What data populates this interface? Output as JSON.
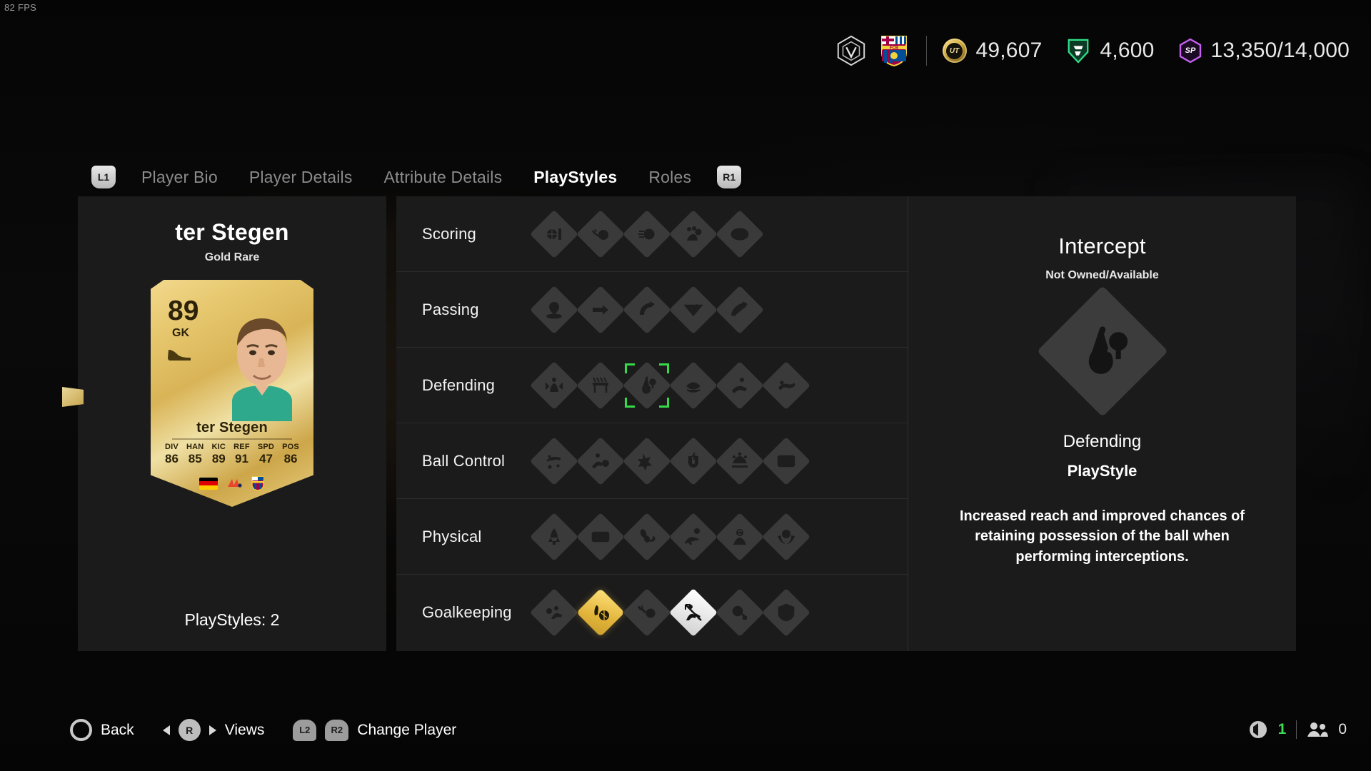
{
  "hud": {
    "fps": "82 FPS",
    "currencies": [
      {
        "id": "ut-coins",
        "icon": "ut-coin-icon",
        "value": "49,607"
      },
      {
        "id": "fc-points",
        "icon": "fc-points-icon",
        "value": "4,600"
      },
      {
        "id": "sp-points",
        "icon": "sp-points-icon",
        "value": "13,350/14,000"
      }
    ],
    "club_badge_icon": "club-crest-icon",
    "team_badge_icon": "fc-barcelona-crest-icon"
  },
  "nav": {
    "left_bumper": "L1",
    "right_bumper": "R1",
    "tabs": [
      {
        "label": "Player Bio",
        "active": false
      },
      {
        "label": "Player Details",
        "active": false
      },
      {
        "label": "Attribute Details",
        "active": false
      },
      {
        "label": "PlayStyles",
        "active": true
      },
      {
        "label": "Roles",
        "active": false
      }
    ]
  },
  "player": {
    "name": "ter Stegen",
    "rarity": "Gold Rare",
    "rating": "89",
    "position": "GK",
    "card_name": "ter Stegen",
    "nation": "Germany",
    "league": "LALIGA",
    "club": "FC Barcelona",
    "stats": [
      {
        "key": "DIV",
        "value": "86"
      },
      {
        "key": "HAN",
        "value": "85"
      },
      {
        "key": "KIC",
        "value": "89"
      },
      {
        "key": "REF",
        "value": "91"
      },
      {
        "key": "SPD",
        "value": "47"
      },
      {
        "key": "POS",
        "value": "86"
      }
    ],
    "playstyles_count_label": "PlayStyles: 2"
  },
  "categories": [
    {
      "label": "Scoring",
      "styles": [
        {
          "name": "finesse-shot",
          "icon": "finesse-shot-icon",
          "state": "unowned"
        },
        {
          "name": "chip-shot",
          "icon": "chip-shot-icon",
          "state": "unowned"
        },
        {
          "name": "power-shot",
          "icon": "power-shot-icon",
          "state": "unowned"
        },
        {
          "name": "dead-ball",
          "icon": "dead-ball-icon",
          "state": "unowned"
        },
        {
          "name": "power-header",
          "icon": "power-header-icon",
          "state": "unowned"
        }
      ]
    },
    {
      "label": "Passing",
      "styles": [
        {
          "name": "pinged-pass",
          "icon": "pinged-pass-icon",
          "state": "unowned"
        },
        {
          "name": "incisive-pass",
          "icon": "incisive-pass-icon",
          "state": "unowned"
        },
        {
          "name": "long-ball-pass",
          "icon": "long-ball-pass-icon",
          "state": "unowned"
        },
        {
          "name": "tiki-taka",
          "icon": "tiki-taka-icon",
          "state": "unowned"
        },
        {
          "name": "whipped-pass",
          "icon": "whipped-pass-icon",
          "state": "unowned"
        }
      ]
    },
    {
      "label": "Defending",
      "styles": [
        {
          "name": "block",
          "icon": "block-icon",
          "state": "unowned"
        },
        {
          "name": "bruiser",
          "icon": "bruiser-icon",
          "state": "unowned"
        },
        {
          "name": "intercept",
          "icon": "intercept-icon",
          "state": "unowned",
          "selected": true
        },
        {
          "name": "jockey",
          "icon": "jockey-icon",
          "state": "unowned"
        },
        {
          "name": "slide-tackle",
          "icon": "slide-tackle-icon",
          "state": "unowned"
        },
        {
          "name": "anticipate",
          "icon": "anticipate-icon",
          "state": "unowned"
        }
      ]
    },
    {
      "label": "Ball Control",
      "styles": [
        {
          "name": "first-touch",
          "icon": "first-touch-icon",
          "state": "unowned"
        },
        {
          "name": "flair",
          "icon": "flair-icon",
          "state": "unowned"
        },
        {
          "name": "press-proven",
          "icon": "press-proven-icon",
          "state": "unowned"
        },
        {
          "name": "rapid",
          "icon": "rapid-icon",
          "state": "unowned"
        },
        {
          "name": "technical",
          "icon": "technical-icon",
          "state": "unowned"
        },
        {
          "name": "trickster",
          "icon": "trickster-icon",
          "state": "unowned"
        }
      ]
    },
    {
      "label": "Physical",
      "styles": [
        {
          "name": "acrobatic",
          "icon": "acrobatic-icon",
          "state": "unowned"
        },
        {
          "name": "aerial",
          "icon": "aerial-icon",
          "state": "unowned"
        },
        {
          "name": "trivela",
          "icon": "trivela-icon",
          "state": "unowned"
        },
        {
          "name": "relentless",
          "icon": "relentless-icon",
          "state": "unowned"
        },
        {
          "name": "quick-step",
          "icon": "quick-step-icon",
          "state": "unowned"
        },
        {
          "name": "long-throw",
          "icon": "long-throw-icon",
          "state": "unowned"
        }
      ]
    },
    {
      "label": "Goalkeeping",
      "styles": [
        {
          "name": "footwork",
          "icon": "footwork-icon",
          "state": "unowned"
        },
        {
          "name": "cross-claimer",
          "icon": "cross-claimer-icon",
          "state": "plus"
        },
        {
          "name": "rush-out",
          "icon": "rush-out-icon",
          "state": "unowned"
        },
        {
          "name": "far-throw",
          "icon": "far-throw-icon",
          "state": "owned"
        },
        {
          "name": "far-reach",
          "icon": "far-reach-icon",
          "state": "unowned"
        },
        {
          "name": "quick-reflexes",
          "icon": "quick-reflexes-icon",
          "state": "unowned"
        }
      ]
    }
  ],
  "detail": {
    "title": "Intercept",
    "ownership": "Not Owned/Available",
    "icon": "intercept-icon",
    "category": "Defending",
    "type": "PlayStyle",
    "description": "Increased reach and improved chances of retaining possession of the ball when performing interceptions."
  },
  "footer": {
    "actions": [
      {
        "button": "circle",
        "label": "Back"
      },
      {
        "button": "right-stick",
        "label": "Views"
      },
      {
        "button": "L2R2",
        "label": "Change Player"
      }
    ],
    "audio_count": "1",
    "players_count": "0"
  }
}
